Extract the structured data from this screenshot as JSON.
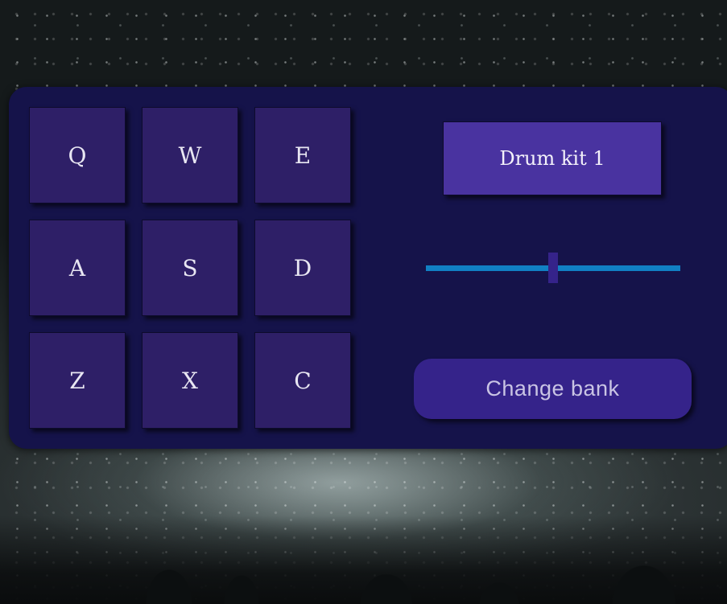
{
  "pads": [
    {
      "key": "Q"
    },
    {
      "key": "W"
    },
    {
      "key": "E"
    },
    {
      "key": "A"
    },
    {
      "key": "S"
    },
    {
      "key": "D"
    },
    {
      "key": "Z"
    },
    {
      "key": "X"
    },
    {
      "key": "C"
    }
  ],
  "display": {
    "text": "Drum kit 1"
  },
  "volume": {
    "value": 0.5
  },
  "bank_button": {
    "label": "Change bank"
  },
  "colors": {
    "panel": "#15134a",
    "pad": "#2e1f67",
    "display": "#4933a0",
    "slider_track": "#1180c4",
    "slider_thumb": "#35238a",
    "button": "#35238a"
  }
}
